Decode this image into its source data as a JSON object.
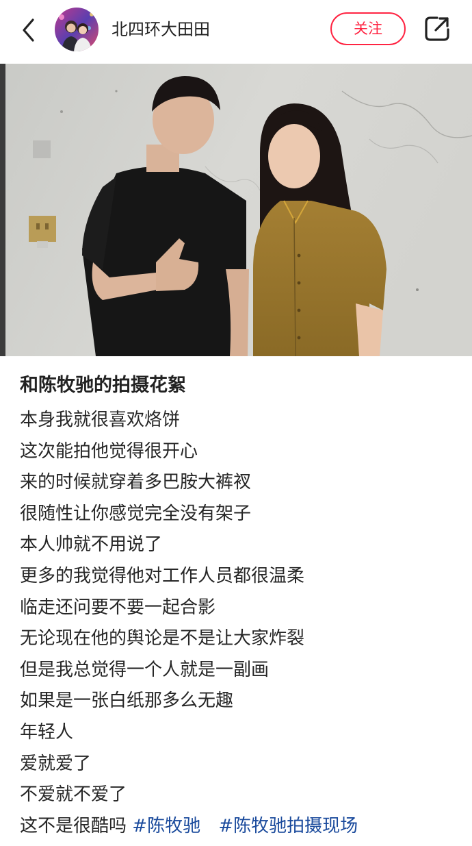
{
  "header": {
    "username": "北四环大田田",
    "follow_label": "关注",
    "back_icon": "chevron-left-icon",
    "share_icon": "share-icon"
  },
  "post": {
    "title": "和陈牧驰的拍摄花絮",
    "lines": [
      "本身我就很喜欢烙饼",
      "这次能拍他觉得很开心",
      "来的时候就穿着多巴胺大裤衩",
      "很随性让你感觉完全没有架子",
      "本人帅就不用说了",
      "更多的我觉得他对工作人员都很温柔",
      "临走还问要不要一起合影",
      "无论现在他的舆论是不是让大家炸裂",
      "但是我总觉得一个人就是一副画",
      "如果是一张白纸那多么无趣",
      "年轻人",
      "爱就爱了",
      "不爱就不爱了"
    ],
    "last_line_text": "这不是很酷吗",
    "hashtags": [
      "#陈牧驰",
      "#陈牧驰拍摄现场"
    ]
  },
  "colors": {
    "accent": "#ff2442",
    "hashtag": "#1a4a9c",
    "text": "#222222",
    "background": "#ffffff"
  }
}
